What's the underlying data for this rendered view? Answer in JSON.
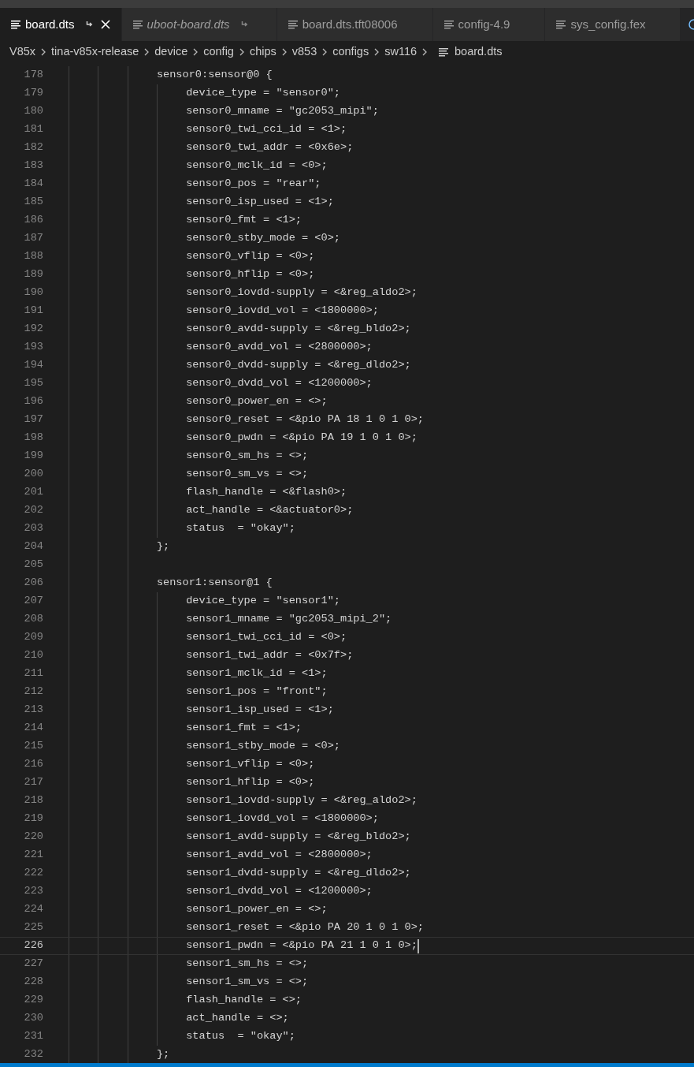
{
  "tabs": [
    {
      "label": "board.dts",
      "selected": true,
      "preview": false,
      "linked": true
    },
    {
      "label": "uboot-board.dts",
      "selected": false,
      "preview": true,
      "linked": true
    },
    {
      "label": "board.dts.tft08006",
      "selected": false,
      "preview": false,
      "linked": false
    },
    {
      "label": "config-4.9",
      "selected": false,
      "preview": false,
      "linked": false
    },
    {
      "label": "sys_config.fex",
      "selected": false,
      "preview": false,
      "linked": false
    }
  ],
  "breadcrumbs": [
    "V85x",
    "tina-v85x-release",
    "device",
    "config",
    "chips",
    "v853",
    "configs",
    "sw116",
    "board.dts"
  ],
  "code": [
    {
      "number": "178",
      "current": false,
      "text": "sensor0:sensor@0 {",
      "children": [
        {
          "number": "179",
          "current": false,
          "text": "device_type = \"sensor0\";"
        },
        {
          "number": "180",
          "current": false,
          "text": "sensor0_mname = \"gc2053_mipi\";"
        },
        {
          "number": "181",
          "current": false,
          "text": "sensor0_twi_cci_id = <1>;"
        },
        {
          "number": "182",
          "current": false,
          "text": "sensor0_twi_addr = <0x6e>;"
        },
        {
          "number": "183",
          "current": false,
          "text": "sensor0_mclk_id = <0>;"
        },
        {
          "number": "184",
          "current": false,
          "text": "sensor0_pos = \"rear\";"
        },
        {
          "number": "185",
          "current": false,
          "text": "sensor0_isp_used = <1>;"
        },
        {
          "number": "186",
          "current": false,
          "text": "sensor0_fmt = <1>;"
        },
        {
          "number": "187",
          "current": false,
          "text": "sensor0_stby_mode = <0>;"
        },
        {
          "number": "188",
          "current": false,
          "text": "sensor0_vflip = <0>;"
        },
        {
          "number": "189",
          "current": false,
          "text": "sensor0_hflip = <0>;"
        },
        {
          "number": "190",
          "current": false,
          "text": "sensor0_iovdd-supply = <&reg_aldo2>;"
        },
        {
          "number": "191",
          "current": false,
          "text": "sensor0_iovdd_vol = <1800000>;"
        },
        {
          "number": "192",
          "current": false,
          "text": "sensor0_avdd-supply = <&reg_bldo2>;"
        },
        {
          "number": "193",
          "current": false,
          "text": "sensor0_avdd_vol = <2800000>;"
        },
        {
          "number": "194",
          "current": false,
          "text": "sensor0_dvdd-supply = <&reg_dldo2>;"
        },
        {
          "number": "195",
          "current": false,
          "text": "sensor0_dvdd_vol = <1200000>;"
        },
        {
          "number": "196",
          "current": false,
          "text": "sensor0_power_en = <>;"
        },
        {
          "number": "197",
          "current": false,
          "text": "sensor0_reset = <&pio PA 18 1 0 1 0>;"
        },
        {
          "number": "198",
          "current": false,
          "text": "sensor0_pwdn = <&pio PA 19 1 0 1 0>;"
        },
        {
          "number": "199",
          "current": false,
          "text": "sensor0_sm_hs = <>;"
        },
        {
          "number": "200",
          "current": false,
          "text": "sensor0_sm_vs = <>;"
        },
        {
          "number": "201",
          "current": false,
          "text": "flash_handle = <&flash0>;"
        },
        {
          "number": "202",
          "current": false,
          "text": "act_handle = <&actuator0>;"
        },
        {
          "number": "203",
          "current": false,
          "text": "status  = \"okay\";"
        }
      ]
    },
    {
      "number": "204",
      "current": false,
      "text": "};"
    },
    {
      "number": "205",
      "current": false
    },
    {
      "number": "206",
      "current": false,
      "text": "sensor1:sensor@1 {",
      "children": [
        {
          "number": "207",
          "current": false,
          "text": "device_type = \"sensor1\";"
        },
        {
          "number": "208",
          "current": false,
          "text": "sensor1_mname = \"gc2053_mipi_2\";"
        },
        {
          "number": "209",
          "current": false,
          "text": "sensor1_twi_cci_id = <0>;"
        },
        {
          "number": "210",
          "current": false,
          "text": "sensor1_twi_addr = <0x7f>;"
        },
        {
          "number": "211",
          "current": false,
          "text": "sensor1_mclk_id = <1>;"
        },
        {
          "number": "212",
          "current": false,
          "text": "sensor1_pos = \"front\";"
        },
        {
          "number": "213",
          "current": false,
          "text": "sensor1_isp_used = <1>;"
        },
        {
          "number": "214",
          "current": false,
          "text": "sensor1_fmt = <1>;"
        },
        {
          "number": "215",
          "current": false,
          "text": "sensor1_stby_mode = <0>;"
        },
        {
          "number": "216",
          "current": false,
          "text": "sensor1_vflip = <0>;"
        },
        {
          "number": "217",
          "current": false,
          "text": "sensor1_hflip = <0>;"
        },
        {
          "number": "218",
          "current": false,
          "text": "sensor1_iovdd-supply = <&reg_aldo2>;"
        },
        {
          "number": "219",
          "current": false,
          "text": "sensor1_iovdd_vol = <1800000>;"
        },
        {
          "number": "220",
          "current": false,
          "text": "sensor1_avdd-supply = <&reg_bldo2>;"
        },
        {
          "number": "221",
          "current": false,
          "text": "sensor1_avdd_vol = <2800000>;"
        },
        {
          "number": "222",
          "current": false,
          "text": "sensor1_dvdd-supply = <&reg_dldo2>;"
        },
        {
          "number": "223",
          "current": false,
          "text": "sensor1_dvdd_vol = <1200000>;"
        },
        {
          "number": "224",
          "current": false,
          "text": "sensor1_power_en = <>;"
        },
        {
          "number": "225",
          "current": false,
          "text": "sensor1_reset = <&pio PA 20 1 0 1 0>;"
        },
        {
          "number": "226",
          "current": true,
          "text": "sensor1_pwdn = <&pio PA 21 1 0 1 0>;"
        },
        {
          "number": "227",
          "current": false,
          "text": "sensor1_sm_hs = <>;"
        },
        {
          "number": "228",
          "current": false,
          "text": "sensor1_sm_vs = <>;"
        },
        {
          "number": "229",
          "current": false,
          "text": "flash_handle = <>;"
        },
        {
          "number": "230",
          "current": false,
          "text": "act_handle = <>;"
        },
        {
          "number": "231",
          "current": false,
          "text": "status  = \"okay\";"
        }
      ]
    },
    {
      "number": "232",
      "current": false,
      "text": "};"
    }
  ]
}
